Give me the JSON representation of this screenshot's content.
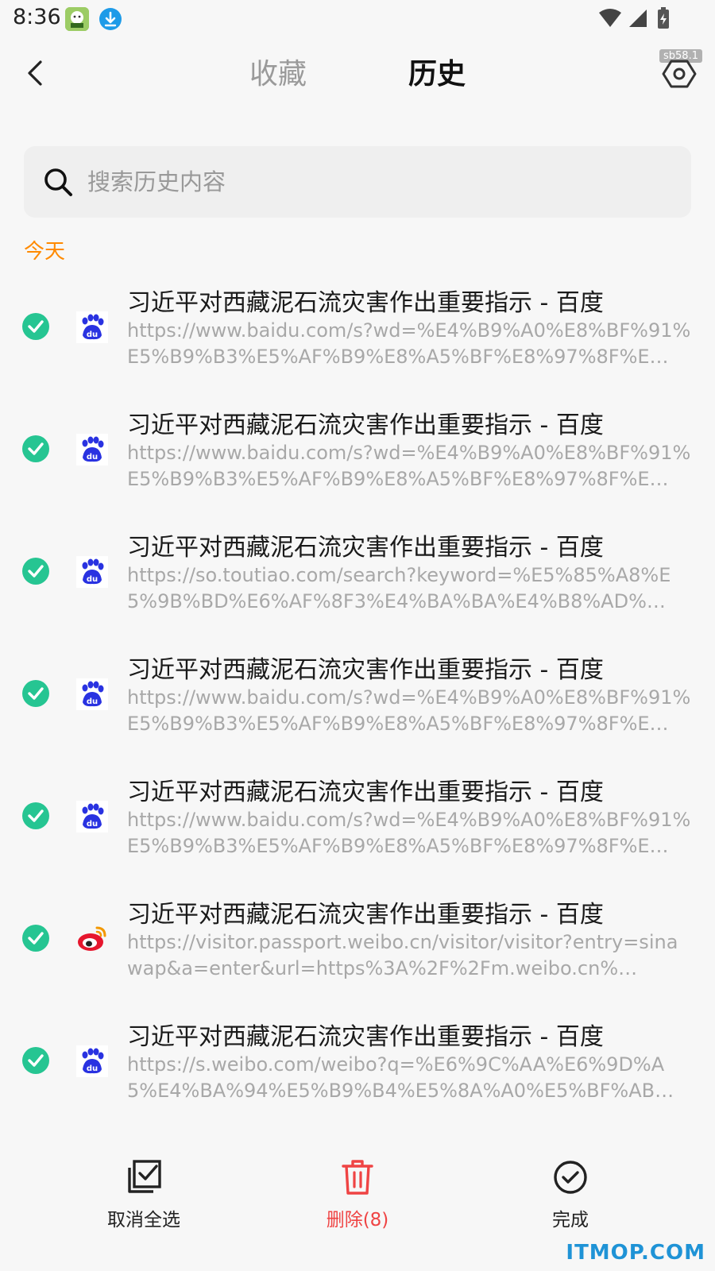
{
  "status_bar": {
    "time": "8:36",
    "icons": [
      "app-notification-icon",
      "download-icon",
      "wifi-icon",
      "cellular-signal-icon",
      "battery-charging-icon"
    ]
  },
  "header": {
    "tabs": [
      {
        "label": "收藏",
        "active": false
      },
      {
        "label": "历史",
        "active": true
      }
    ],
    "debug_badge": "sb58.1",
    "icons": {
      "back": "chevron-left-icon",
      "settings": "hexagon-settings-icon"
    }
  },
  "search": {
    "placeholder": "搜索历史内容"
  },
  "section": {
    "label": "今天"
  },
  "history": [
    {
      "title": "习近平对西藏泥石流灾害作出重要指示 - 百度",
      "url": "https://www.baidu.com/s?wd=%E4%B9%A0%E8%BF%91%E5%B9%B3%E5%AF%B9%E8%A5%BF%E8%97%8F%E…",
      "favicon": "baidu",
      "selected": true
    },
    {
      "title": "习近平对西藏泥石流灾害作出重要指示 - 百度",
      "url": "https://www.baidu.com/s?wd=%E4%B9%A0%E8%BF%91%E5%B9%B3%E5%AF%B9%E8%A5%BF%E8%97%8F%E…",
      "favicon": "baidu",
      "selected": true
    },
    {
      "title": "习近平对西藏泥石流灾害作出重要指示 - 百度",
      "url": "https://so.toutiao.com/search?keyword=%E5%85%A8%E5%9B%BD%E6%AF%8F3%E4%BA%BA%E4%B8%AD%…",
      "favicon": "baidu",
      "selected": true
    },
    {
      "title": "习近平对西藏泥石流灾害作出重要指示 - 百度",
      "url": "https://www.baidu.com/s?wd=%E4%B9%A0%E8%BF%91%E5%B9%B3%E5%AF%B9%E8%A5%BF%E8%97%8F%E…",
      "favicon": "baidu",
      "selected": true
    },
    {
      "title": "习近平对西藏泥石流灾害作出重要指示 - 百度",
      "url": "https://www.baidu.com/s?wd=%E4%B9%A0%E8%BF%91%E5%B9%B3%E5%AF%B9%E8%A5%BF%E8%97%8F%E…",
      "favicon": "baidu",
      "selected": true
    },
    {
      "title": "习近平对西藏泥石流灾害作出重要指示 - 百度",
      "url": "https://visitor.passport.weibo.cn/visitor/visitor?entry=sinawap&a=enter&url=https%3A%2F%2Fm.weibo.cn%…",
      "favicon": "weibo",
      "selected": true
    },
    {
      "title": "习近平对西藏泥石流灾害作出重要指示 - 百度",
      "url": "https://s.weibo.com/weibo?q=%E6%9C%AA%E6%9D%A5%E4%BA%94%E5%B9%B4%E5%8A%A0%E5%BF%AB%E…",
      "favicon": "baidu",
      "selected": true
    }
  ],
  "bottom_bar": {
    "deselect_all": "取消全选",
    "delete": "删除(8)",
    "done": "完成"
  },
  "watermark": "ITMOP.COM",
  "colors": {
    "accent_orange": "#ff8a00",
    "check_green": "#26c592",
    "delete_red": "#ef4444",
    "baidu_blue": "#2932e1",
    "weibo_red": "#e6162d"
  }
}
